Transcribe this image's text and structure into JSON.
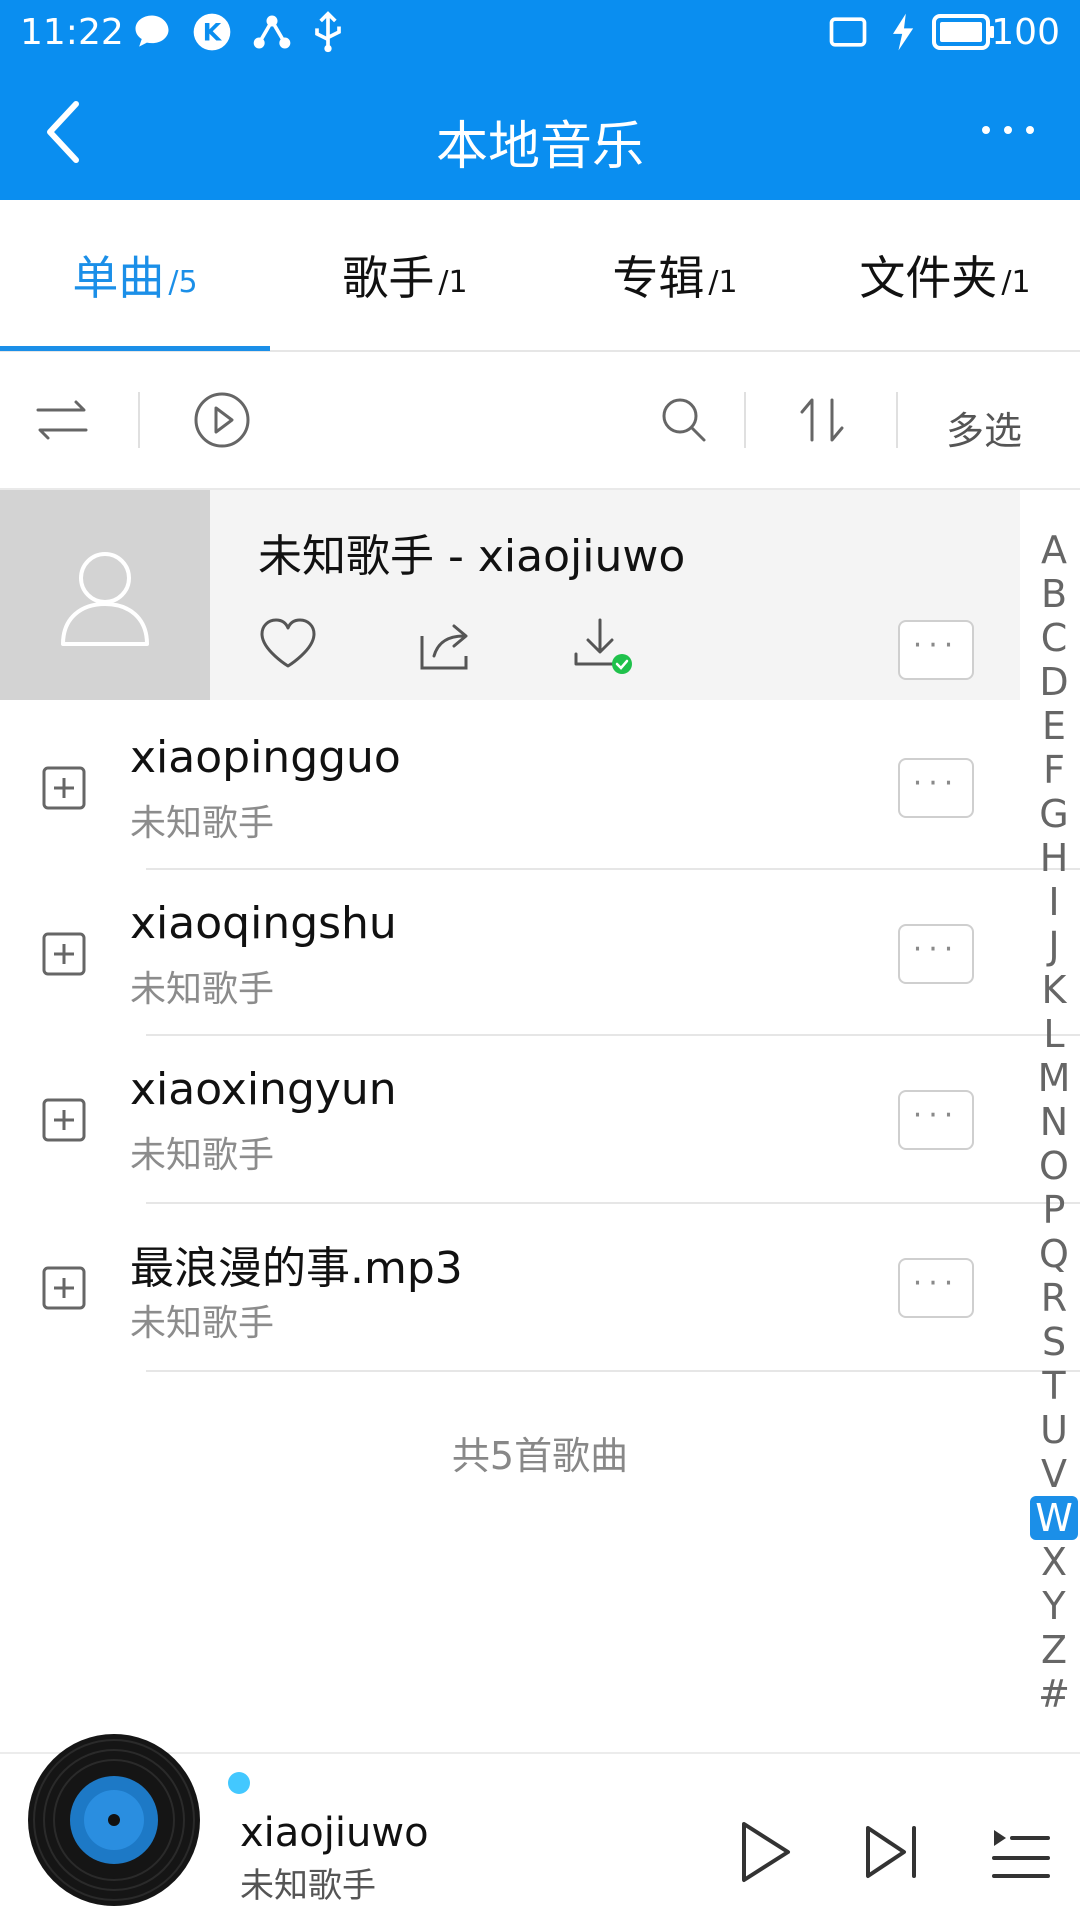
{
  "status_bar": {
    "time": "11:22",
    "battery": "100",
    "icons": [
      "chat-icon",
      "k-icon",
      "share-icon",
      "usb-icon",
      "tablet-icon",
      "charging-icon",
      "battery-icon"
    ]
  },
  "header": {
    "title": "本地音乐",
    "back_icon": "back-arrow-icon",
    "more_icon": "more-horizontal-icon"
  },
  "tabs": [
    {
      "label": "单曲",
      "count": "/5",
      "active": true
    },
    {
      "label": "歌手",
      "count": "/1",
      "active": false
    },
    {
      "label": "专辑",
      "count": "/1",
      "active": false
    },
    {
      "label": "文件夹",
      "count": "/1",
      "active": false
    }
  ],
  "toolbar": {
    "multi_select": "多选",
    "icons": [
      "shuffle-icon",
      "play-circle-icon",
      "search-icon",
      "sort-icon"
    ]
  },
  "now_playing_row": {
    "title": "未知歌手 - xiaojiuwo",
    "actions": [
      "heart-icon",
      "share-icon",
      "downloaded-icon"
    ],
    "more_label": "···"
  },
  "songs": [
    {
      "title": "xiaopingguo",
      "artist": "未知歌手"
    },
    {
      "title": "xiaoqingshu",
      "artist": "未知歌手"
    },
    {
      "title": "xiaoxingyun",
      "artist": "未知歌手"
    },
    {
      "title": "最浪漫的事.mp3",
      "artist": "未知歌手"
    }
  ],
  "footer_count": "共5首歌曲",
  "index_letters": [
    "A",
    "B",
    "C",
    "D",
    "E",
    "F",
    "G",
    "H",
    "I",
    "J",
    "K",
    "L",
    "M",
    "N",
    "O",
    "P",
    "Q",
    "R",
    "S",
    "T",
    "U",
    "V",
    "W",
    "X",
    "Y",
    "Z",
    "#"
  ],
  "index_active": "W",
  "player": {
    "title": "xiaojiuwo",
    "artist": "未知歌手",
    "buttons": [
      "play-icon",
      "next-icon",
      "playlist-icon"
    ]
  },
  "colors": {
    "accent": "#0a8ef0",
    "tab_active": "#1b8fe8",
    "divider": "#e6e6e6",
    "secondary_text": "#8c8c8c"
  }
}
